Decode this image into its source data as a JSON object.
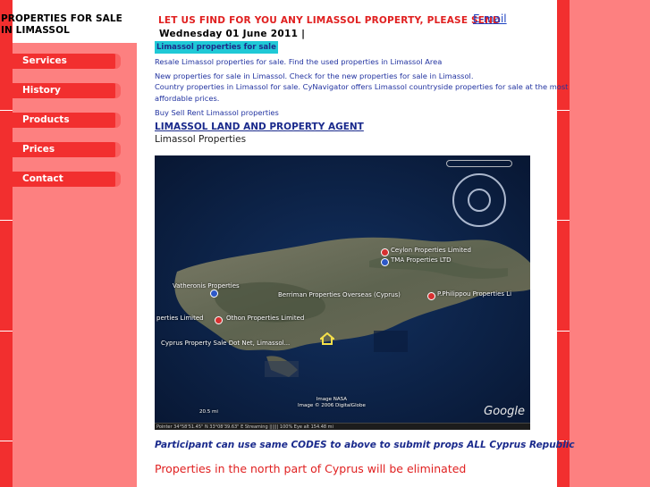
{
  "sidebar": {
    "site_title": "PROPERTIES FOR SALE IN LIMASSOL",
    "nav": [
      {
        "label": "Services"
      },
      {
        "label": "History"
      },
      {
        "label": "Products"
      },
      {
        "label": "Prices"
      },
      {
        "label": "Contact"
      }
    ]
  },
  "header": {
    "headline": "LET US FIND FOR YOU ANY LIMASSOL PROPERTY, PLEASE SEND",
    "email_link": "E-mail",
    "date": "Wednesday 01 June 2011 |"
  },
  "content": {
    "highlight": "Limassol properties for sale",
    "lines": [
      "Resale Limassol properties for sale.  Find the used properties in Limassol Area",
      "New properties for sale in Limassol.  Check for the new properties for sale in Limassol.",
      "Country properties in Limassol for sale.  CyNavigator offers Limassol countryside properties for sale at the most",
      "affordable prices.",
      "Buy Sell Rent Limassol properties"
    ],
    "agent_link": "LIMASSOL LAND AND PROPERTY AGENT",
    "subtitle": "Limassol Properties",
    "participant": "Participant can use same CODES to above to submit props ALL Cyprus Republic",
    "north_notice": "Properties in the north part of Cyprus will be eliminated"
  },
  "map": {
    "labels": [
      {
        "text": "Ceylon Properties Limited",
        "pin": "red"
      },
      {
        "text": "TMA Properties LTD",
        "pin": "blue"
      },
      {
        "text": "Vatheronis Properties",
        "pin": "blue"
      },
      {
        "text": "Berriman Properties Overseas (Cyprus)",
        "pin": "none"
      },
      {
        "text": "P.Philippou Properties Li",
        "pin": "red"
      },
      {
        "text": "perties Limited",
        "pin": "none"
      },
      {
        "text": "Othon Properties Limited",
        "pin": "red"
      },
      {
        "text": "Cyprus Property Sale Dot Net, Limassol...",
        "pin": "none"
      }
    ],
    "imagery_credit": "Image NASA\nImage © 2006 DigitalGlobe",
    "google_logo": "Google",
    "scale": "20.5 mi",
    "status": "Pointer  34°58'51.45\" N   33°08'39.63\" E     Streaming |||||| 100%                      Eye alt  154.48 mi",
    "colors": {
      "sea": "#0b1e44",
      "land": "#6a6a58"
    }
  },
  "colors": {
    "accent_red": "#f22f2f",
    "sidebar_pink": "#fd8080",
    "link_blue": "#1a2a8c",
    "highlight_cyan": "#1fc9d6"
  }
}
